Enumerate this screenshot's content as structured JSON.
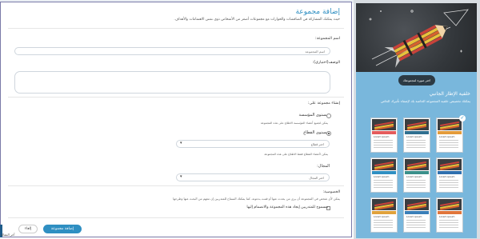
{
  "form": {
    "title": "إضافة مجموعة",
    "subtitle": "حيث يمكنك المشاركة في المناقشات والحوارات مع مجموعات أصغر من الأشخاص ذوي نفس الاهتمامات والأهداف.",
    "group_name_label": "اسم المجموعة:",
    "group_name_placeholder": "اسم المجموعة",
    "description_label": "الوصف(اختياري):",
    "create_on_label": "إنشاء مجموعة على:",
    "option_institution_title": "مستوى المؤسسة",
    "option_institution_desc": "يمكن لجميع أعضاء المؤسسة الاطلاع على هذه المجموعة",
    "option_sector_title": "مستوى القطاع",
    "sector_select_placeholder": "اختر قطاع",
    "sector_desc": "يمكن لأعضاء القطاع فقط الاطلاع على هذه المجموعة",
    "field_label": "المجال:",
    "field_select_placeholder": "اختر المجال",
    "privacy_label": "الخصوصية:",
    "privacy_desc": "يمكن لأي شخص في المجموعة أن يرى من يحدث عنها أو قمت بدعوته. كما يمكنك السماح للمتدربين إن معهم من البحث عنها وطرحها",
    "privacy_checkbox_label": "مسموح للمتدربين إيجاد هذه المجموعة والانضمام إليها",
    "add_button": "إضافة مجموعة",
    "cancel_button": "إلغاء",
    "corner_text": "آخر المقالة"
  },
  "side": {
    "choose_image_button": "اختر صورة لمجموعتك",
    "background_title": "خلفية الإطار الجانبي",
    "background_desc": "يمكنك تخصيص خلفية المجموعة الخاصة بك لإضفاء تأثيرك الخاص",
    "thumb_title": "Lorem ipsum",
    "thumb_colors": [
      "#e45b5b",
      "#2f6f8f",
      "#e39b3a",
      "#2f8fc2",
      "#3a8f8a",
      "#2f6fae",
      "#e0a23b",
      "#3a7fb8",
      "#e0753b"
    ]
  },
  "colors": {
    "accent": "#2f8fc2",
    "panel_blue": "#79b7dc",
    "hero_dark": "#33373b"
  }
}
